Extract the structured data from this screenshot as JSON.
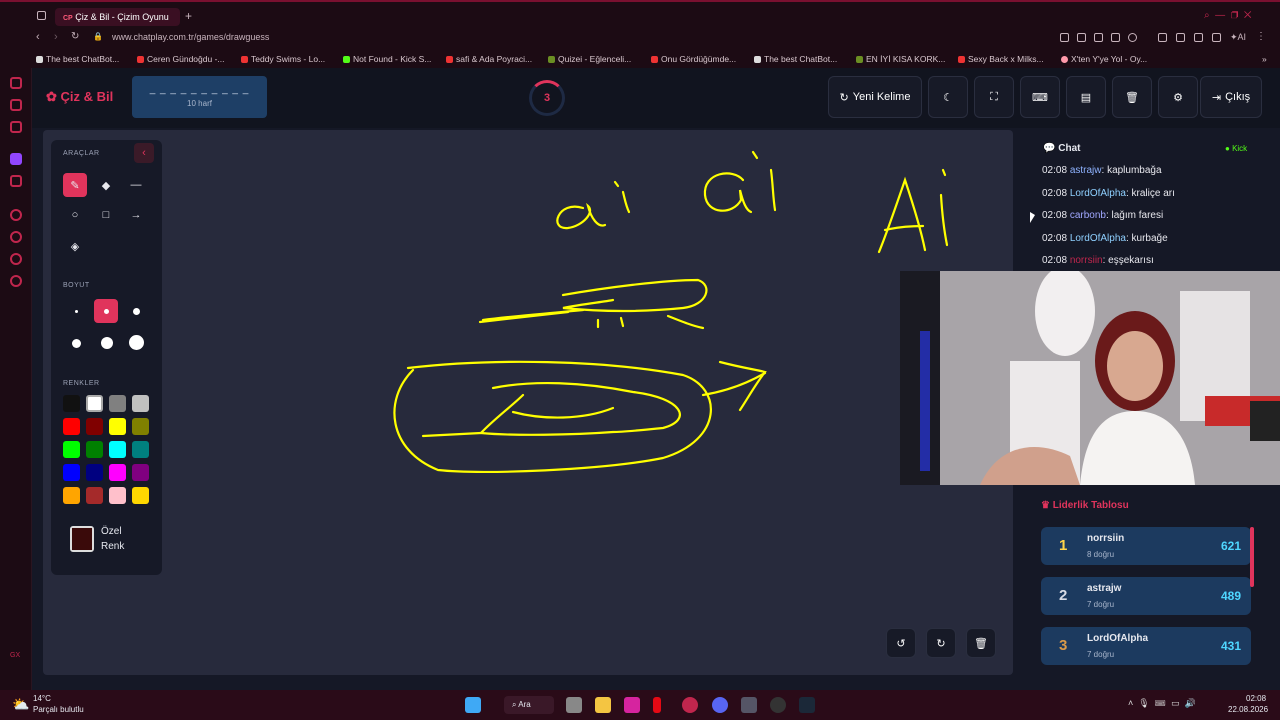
{
  "browser": {
    "tab_title": "Çiz & Bil - Çizim Oyunu",
    "url": "www.chatplay.com.tr/games/drawguess",
    "bookmarks": [
      "The best ChatBot...",
      "Ceren Gündoğdu -...",
      "Teddy Swims - Lo...",
      "Not Found - Kick S...",
      "safi & Ada Poyraci...",
      "Quizei - Eğlenceli...",
      "Onu Gördüğümde...",
      "The best ChatBot...",
      "EN İYİ KISA KORK...",
      "Sexy Back x Milks...",
      "X'ten Y'ye Yol - Oy..."
    ]
  },
  "app": {
    "logo": "Çiz & Bil",
    "word_mask": "_ _ _ _ _ _ _ _ _ _",
    "word_len": "10 harf",
    "timer": "3",
    "btn_new_word": "Yeni Kelime",
    "btn_exit": "Çıkış"
  },
  "tools": {
    "title": "ARAÇLAR",
    "size_title": "BOYUT",
    "colors_title": "RENKLER",
    "custom_color": [
      "Özel",
      "Renk"
    ],
    "palette": [
      "#111111",
      "#ffffff",
      "#808080",
      "#c0c0c0",
      "#ff0000",
      "#800000",
      "#ffff00",
      "#808000",
      "#00ff00",
      "#008000",
      "#00ffff",
      "#008080",
      "#0000ff",
      "#000080",
      "#ff00ff",
      "#800080",
      "#ffa500",
      "#a52a2a",
      "#ffc0cb",
      "#ffd700"
    ],
    "custom_swatch": "#3a0a0a"
  },
  "chat": {
    "title": "Chat",
    "platform": "Kick",
    "messages": [
      {
        "time": "02:08",
        "user": "astrajw",
        "text": "kaplumbağa",
        "color": "#8fb3ff"
      },
      {
        "time": "02:08",
        "user": "LordOfAlpha",
        "text": "kraliçe arı",
        "color": "#8fd0ff"
      },
      {
        "time": "02:08",
        "user": "carbonb",
        "text": "lağım faresi",
        "color": "#a0a8ff"
      },
      {
        "time": "02:08",
        "user": "LordOfAlpha",
        "text": "kurbağe",
        "color": "#8fd0ff"
      },
      {
        "time": "02:08",
        "user": "norrsiin",
        "text": "eşşekarısı",
        "color": "#c0264d"
      }
    ]
  },
  "leaderboard": {
    "title": "Liderlik Tablosu",
    "rows": [
      {
        "rank": "1",
        "name": "norrsiin",
        "sub": "8 doğru",
        "score": "621",
        "rank_color": "#ffd54a"
      },
      {
        "rank": "2",
        "name": "astrajw",
        "sub": "7 doğru",
        "score": "489",
        "rank_color": "#d8dce6"
      },
      {
        "rank": "3",
        "name": "LordOfAlpha",
        "sub": "7 doğru",
        "score": "431",
        "rank_color": "#d99a4a"
      }
    ]
  },
  "taskbar": {
    "weather_temp": "14°C",
    "weather_text": "Parçalı bulutlu",
    "search": "Ara",
    "time": "02:08",
    "date": "22.08.2026"
  },
  "colors": {
    "accent": "#e0345c",
    "ink": "#ffff00"
  }
}
